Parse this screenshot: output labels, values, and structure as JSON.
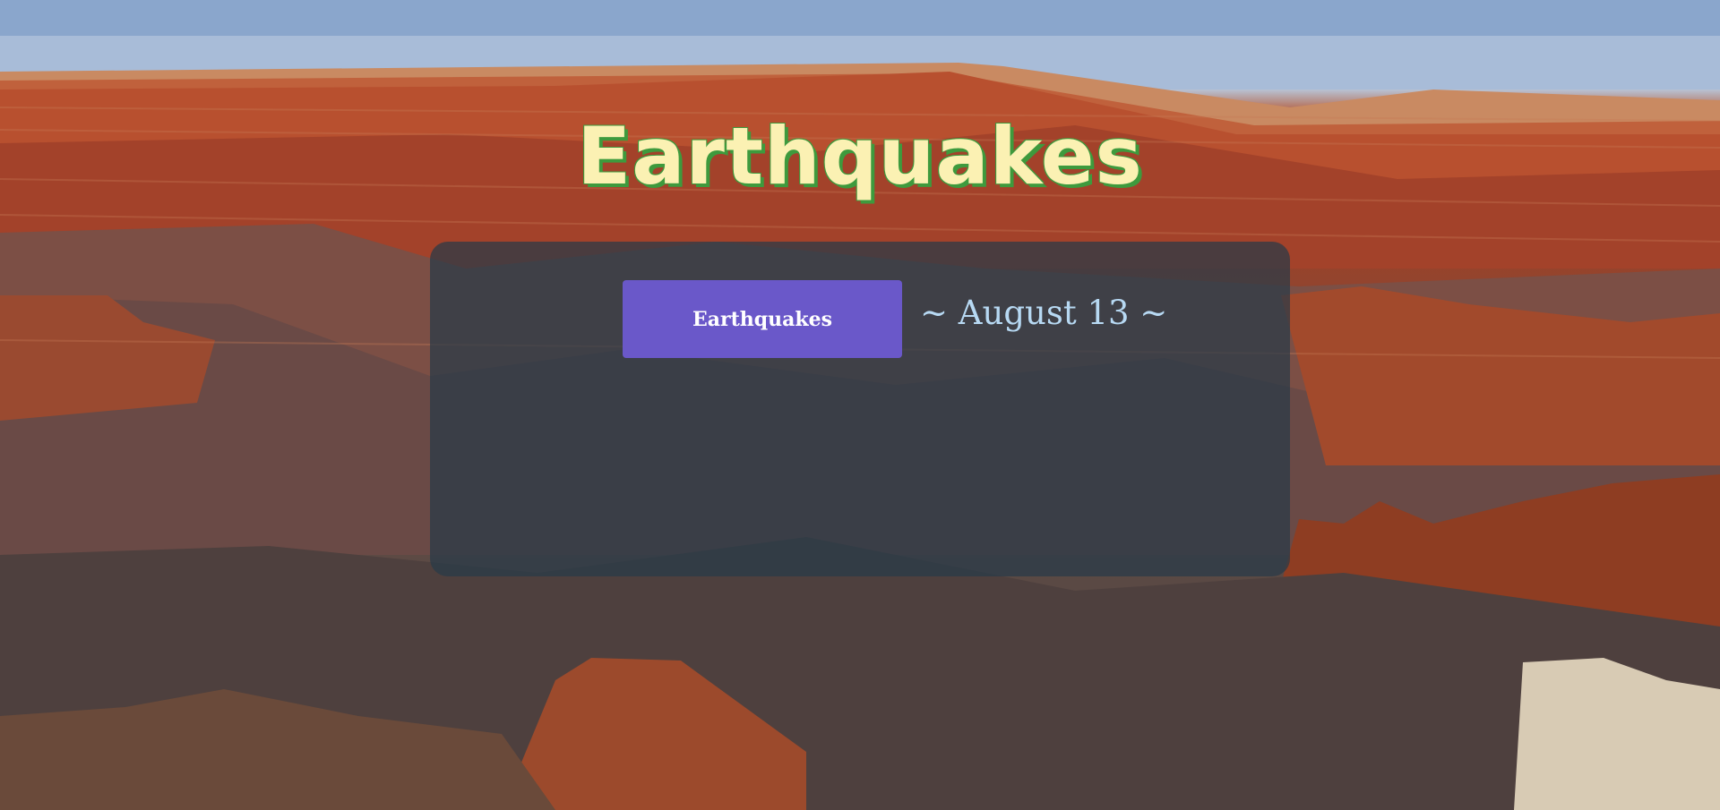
{
  "page": {
    "title": "Earthquakes"
  },
  "panel": {
    "button_label": "Earthquakes",
    "date_text": "~ August 13 ~"
  },
  "colors": {
    "title_fill": "#fbf1b3",
    "title_outline": "#3e9a3d",
    "panel_bg": "rgba(40, 58, 72, 0.72)",
    "button_bg": "#6a58c9",
    "date_text": "#b7d9f3"
  },
  "background": {
    "description_icon": "canyon-landscape-image"
  }
}
